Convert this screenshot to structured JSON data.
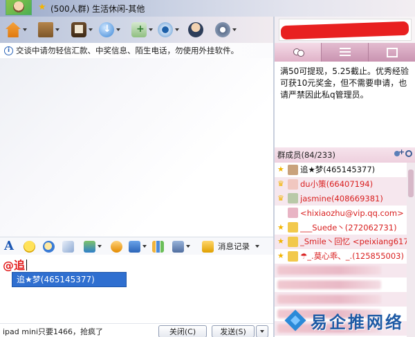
{
  "window": {
    "title": "(500人群) 生活休闲-其他"
  },
  "toolbar": {
    "icons": [
      "home-icon",
      "folder-icon",
      "book-icon",
      "download-icon",
      "app-icon",
      "webcam-icon",
      "person-icon",
      "gear-icon"
    ]
  },
  "notice": {
    "text": "交谈中请勿轻信汇款、中奖信息、陌生电话，勿使用外挂软件。"
  },
  "input_toolbar": {
    "font_glyph": "A",
    "history_label": "消息记录"
  },
  "input": {
    "mention_text": "@追",
    "suggestion": "追★梦(465145377)"
  },
  "bottom": {
    "ad_text": "ipad mini只要1466，抢疯了",
    "close_label": "关闭(C)",
    "send_label": "发送(S)"
  },
  "announcement": {
    "text": "满50可提现，5.25截止。优秀经验可获10元奖金，但不需要申请，也请严禁因此私q管理员。"
  },
  "members": {
    "header": "群成员(84/233)",
    "list": [
      {
        "name": "追★梦(465145377)",
        "color": "#111111",
        "badge": "★",
        "avatar_color": "#c9a27c"
      },
      {
        "name": "du小策(66407194)",
        "color": "#d92020",
        "badge": "♛",
        "avatar_color": "#f1c7c0"
      },
      {
        "name": "jasmine(408669381)",
        "color": "#d92020",
        "badge": "♛",
        "avatar_color": "#b9c9a8"
      },
      {
        "name": "<hixiaozhu@vip.qq.com>",
        "color": "#d92020",
        "badge": "",
        "avatar_color": "#e8b4c4"
      },
      {
        "name": "___Suede丶(272062731)",
        "color": "#d92020",
        "badge": "★",
        "avatar_color": "#f2c94c"
      },
      {
        "name": "_Smile丶回忆 <peixiang617...",
        "color": "#d92020",
        "badge": "★",
        "avatar_color": "#f2c94c"
      },
      {
        "name": "☂_.莫心乖、_.(125855003)",
        "color": "#d92020",
        "badge": "★",
        "avatar_color": "#f2c94c"
      }
    ]
  },
  "watermark": {
    "text": "易企推网络"
  }
}
